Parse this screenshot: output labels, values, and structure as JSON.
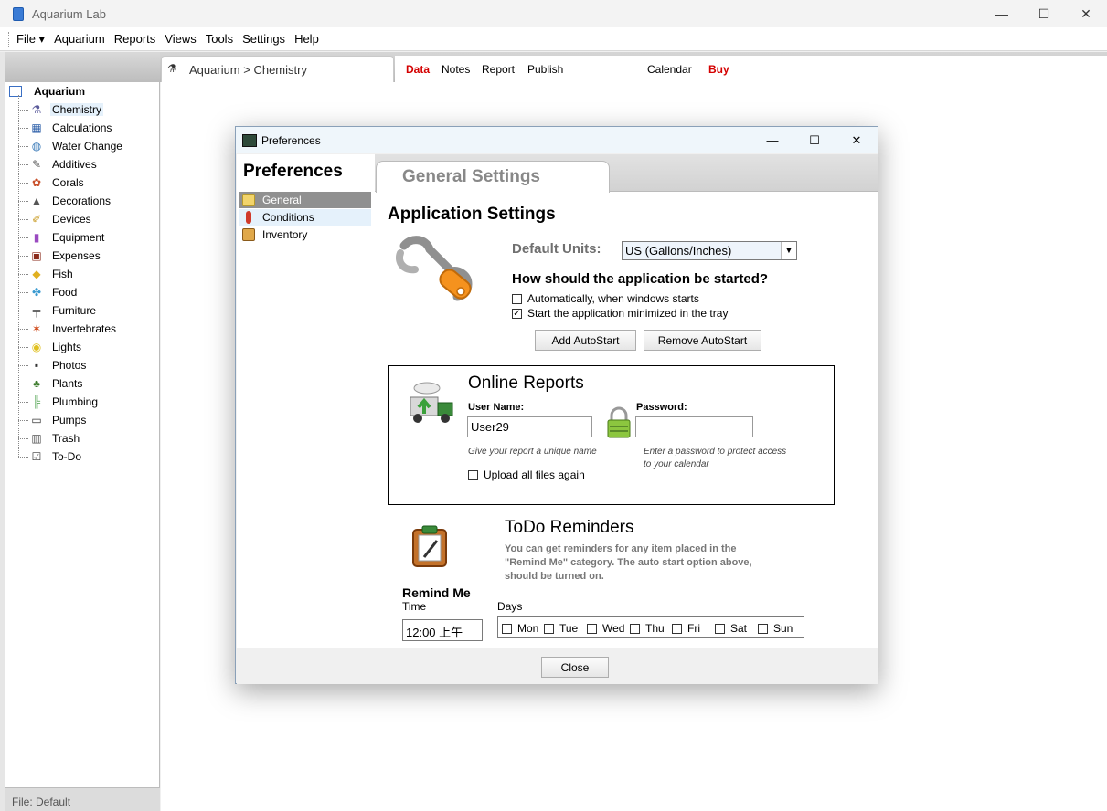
{
  "window": {
    "title": "Aquarium Lab",
    "controls": [
      "—",
      "☐",
      "✕"
    ]
  },
  "menu": [
    "File ▾",
    "Aquarium",
    "Reports",
    "Views",
    "Tools",
    "Settings",
    "Help"
  ],
  "tree": {
    "root": "Aquarium",
    "items": [
      {
        "label": "Chemistry",
        "icon": "flask-icon",
        "glyph": "⚗",
        "color": "#5a5a9a"
      },
      {
        "label": "Calculations",
        "icon": "calculator-icon",
        "glyph": "▦",
        "color": "#2b5ea8"
      },
      {
        "label": "Water Change",
        "icon": "water-change-icon",
        "glyph": "◍",
        "color": "#3a7ab8"
      },
      {
        "label": "Additives",
        "icon": "additives-icon",
        "glyph": "✎",
        "color": "#555"
      },
      {
        "label": "Corals",
        "icon": "coral-icon",
        "glyph": "✿",
        "color": "#c8502a"
      },
      {
        "label": "Decorations",
        "icon": "decoration-icon",
        "glyph": "▲",
        "color": "#555"
      },
      {
        "label": "Devices",
        "icon": "devices-icon",
        "glyph": "✐",
        "color": "#c89a20"
      },
      {
        "label": "Equipment",
        "icon": "equipment-icon",
        "glyph": "▮",
        "color": "#9a4ac0"
      },
      {
        "label": "Expenses",
        "icon": "expenses-icon",
        "glyph": "▣",
        "color": "#8a2a1a"
      },
      {
        "label": "Fish",
        "icon": "fish-icon",
        "glyph": "◆",
        "color": "#e0b020"
      },
      {
        "label": "Food",
        "icon": "food-icon",
        "glyph": "✤",
        "color": "#3a9ad0"
      },
      {
        "label": "Furniture",
        "icon": "furniture-icon",
        "glyph": "╤",
        "color": "#555"
      },
      {
        "label": "Invertebrates",
        "icon": "starfish-icon",
        "glyph": "✶",
        "color": "#d04a1a"
      },
      {
        "label": "Lights",
        "icon": "lightbulb-icon",
        "glyph": "◉",
        "color": "#e0c020"
      },
      {
        "label": "Photos",
        "icon": "camera-icon",
        "glyph": "▪",
        "color": "#333"
      },
      {
        "label": "Plants",
        "icon": "plant-icon",
        "glyph": "♣",
        "color": "#3a7a2a"
      },
      {
        "label": "Plumbing",
        "icon": "plumbing-icon",
        "glyph": "╠",
        "color": "#4aa04a"
      },
      {
        "label": "Pumps",
        "icon": "pump-icon",
        "glyph": "▭",
        "color": "#333"
      },
      {
        "label": "Trash",
        "icon": "trash-icon",
        "glyph": "▥",
        "color": "#555"
      },
      {
        "label": "To-Do",
        "icon": "todo-icon",
        "glyph": "☑",
        "color": "#333"
      }
    ]
  },
  "status": "File: Default",
  "breadcrumb": "Aquarium > Chemistry",
  "topnav": [
    "Data",
    "Notes",
    "Report",
    "Publish",
    "Calendar",
    "Buy"
  ],
  "dialog": {
    "title": "Preferences",
    "controls": [
      "—",
      "☐",
      "✕"
    ],
    "heading": "Preferences",
    "nav": [
      "General",
      "Conditions",
      "Inventory"
    ],
    "tab": "General Settings",
    "app_settings": {
      "title": "Application Settings",
      "units_label": "Default Units:",
      "units_value": "US (Gallons/Inches)",
      "start_question": "How should the application be started?",
      "opt_auto": "Automatically, when windows starts",
      "opt_auto_checked": false,
      "opt_min": "Start the application minimized in the tray",
      "opt_min_checked": true,
      "btn_add": "Add AutoStart",
      "btn_remove": "Remove AutoStart"
    },
    "online": {
      "title": "Online Reports",
      "user_label": "User Name:",
      "user_value": "User29",
      "user_hint": "Give your report a unique name",
      "pass_label": "Password:",
      "pass_value": "",
      "pass_hint_1": "Enter a password to protect access",
      "pass_hint_2": "to your calendar",
      "upload": "Upload all files again",
      "upload_checked": false
    },
    "todo": {
      "title": "ToDo Reminders",
      "desc": "You can get reminders for any item placed in the \"Remind Me\" category. The auto start option above, should be turned on.",
      "remind_me": "Remind Me",
      "time_label": "Time",
      "time_value": "12:00 上午",
      "days_label": "Days",
      "days": [
        "Mon",
        "Tue",
        "Wed",
        "Thu",
        "Fri",
        "Sat",
        "Sun"
      ]
    },
    "close": "Close"
  }
}
